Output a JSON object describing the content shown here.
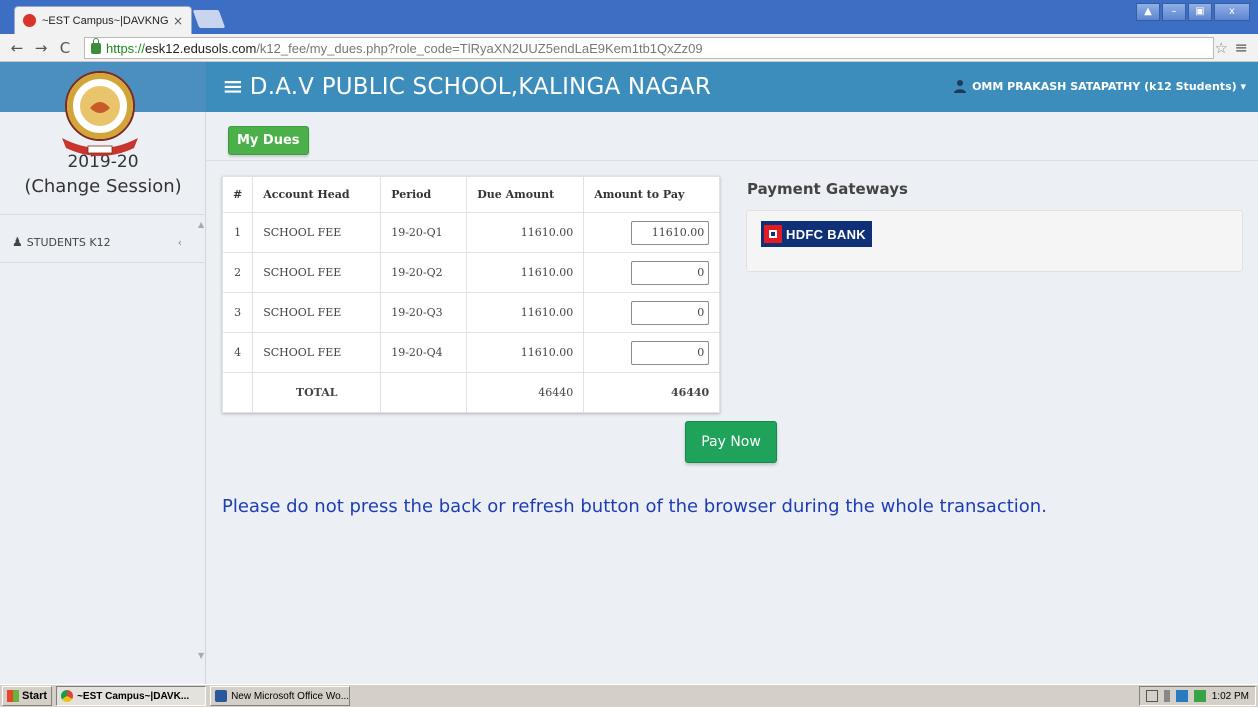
{
  "browser": {
    "tab_title": "~EST Campus~|DAVKNG",
    "tab_close": "×",
    "url_secure": "https://",
    "url_host": "esk12.edusols.com",
    "url_path": "/k12_fee/my_dues.php?role_code=TlRyaXN2UUZ5endLaE9Kem1tb1QxZz09",
    "window_controls": [
      "▲",
      "–",
      "▣",
      "x"
    ]
  },
  "header": {
    "school_name": "D.A.V PUBLIC SCHOOL,KALINGA NAGAR",
    "user": "OMM PRAKASH SATAPATHY (k12 Students) ▾"
  },
  "sidebar": {
    "session_year": "2019-20",
    "session_change": "(Change Session)",
    "menu_item": "STUDENTS K12",
    "menu_arrow": "‹"
  },
  "main": {
    "my_dues_label": "My Dues",
    "table": {
      "headers": [
        "#",
        "Account Head",
        "Period",
        "Due Amount",
        "Amount to Pay"
      ],
      "rows": [
        {
          "no": "1",
          "head": "SCHOOL FEE",
          "period": "19-20-Q1",
          "due": "11610.00",
          "pay": "11610.00"
        },
        {
          "no": "2",
          "head": "SCHOOL FEE",
          "period": "19-20-Q2",
          "due": "11610.00",
          "pay": "0"
        },
        {
          "no": "3",
          "head": "SCHOOL FEE",
          "period": "19-20-Q3",
          "due": "11610.00",
          "pay": "0"
        },
        {
          "no": "4",
          "head": "SCHOOL FEE",
          "period": "19-20-Q4",
          "due": "11610.00",
          "pay": "0"
        }
      ],
      "total_label": "TOTAL",
      "total_due": "46440",
      "total_pay": "46440"
    },
    "payment_gateways_title": "Payment Gateways",
    "gateway_hdfc": "HDFC BANK",
    "pay_now_label": "Pay Now",
    "warning": "Please do not press the back or refresh button of the browser during the whole transaction."
  },
  "taskbar": {
    "start_label": "Start",
    "tasks": [
      "~EST Campus~|DAVK...",
      "New Microsoft Office Wo..."
    ],
    "clock": "1:02 PM"
  },
  "colors": {
    "header_blue": "#3c8dbc",
    "button_green": "#4bb04a",
    "pay_now_green": "#1fa25a",
    "warning_blue": "#1e3db4",
    "hdfc_navy": "#0f3078"
  }
}
